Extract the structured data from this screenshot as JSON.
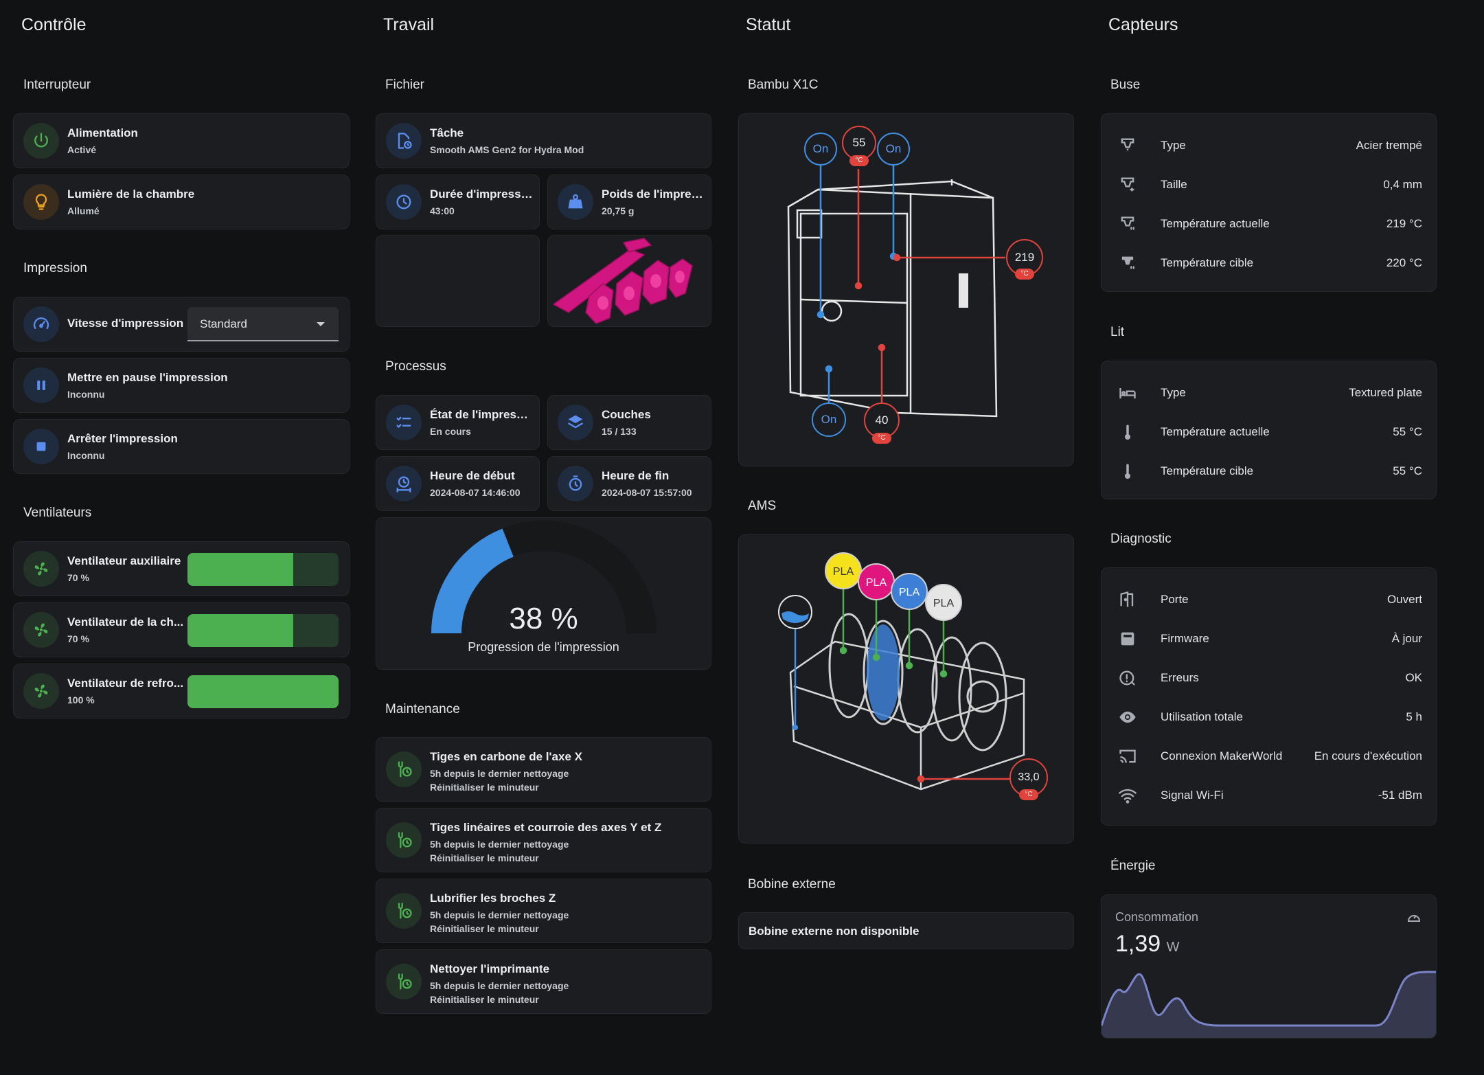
{
  "columns": {
    "controle": "Contrôle",
    "travail": "Travail",
    "statut": "Statut",
    "capteurs": "Capteurs"
  },
  "controle": {
    "interrupteur_title": "Interrupteur",
    "alimentation": {
      "name": "Alimentation",
      "value": "Activé"
    },
    "lumiere": {
      "name": "Lumière de la chambre",
      "value": "Allumé"
    },
    "impression_title": "Impression",
    "vitesse": {
      "name": "Vitesse d'impression",
      "selected": "Standard"
    },
    "pause": {
      "name": "Mettre en pause l'impression",
      "value": "Inconnu"
    },
    "arreter": {
      "name": "Arrêter l'impression",
      "value": "Inconnu"
    },
    "ventilateurs_title": "Ventilateurs",
    "fans": [
      {
        "name": "Ventilateur auxiliaire",
        "value": "70 %",
        "percent": 70
      },
      {
        "name": "Ventilateur de la ch...",
        "value": "70 %",
        "percent": 70
      },
      {
        "name": "Ventilateur de refro...",
        "value": "100 %",
        "percent": 100
      }
    ]
  },
  "travail": {
    "fichier_title": "Fichier",
    "tache": {
      "name": "Tâche",
      "value": "Smooth AMS Gen2 for Hydra Mod"
    },
    "duree": {
      "name": "Durée d'impression",
      "value": "43:00"
    },
    "poids": {
      "name": "Poids de l'impres...",
      "value": "20,75 g"
    },
    "processus_title": "Processus",
    "etat": {
      "name": "État de l'impressi...",
      "value": "En cours"
    },
    "couches": {
      "name": "Couches",
      "value": "15 / 133"
    },
    "debut": {
      "name": "Heure de début",
      "value": "2024-08-07 14:46:00"
    },
    "fin": {
      "name": "Heure de fin",
      "value": "2024-08-07 15:57:00"
    },
    "progress": {
      "value": "38 %",
      "label": "Progression de l'impression",
      "percent": 38
    },
    "maintenance_title": "Maintenance",
    "maintenance": [
      {
        "name": "Tiges en carbone de l'axe X",
        "since": "5h depuis le dernier nettoyage",
        "action": "Réinitialiser le minuteur"
      },
      {
        "name": "Tiges linéaires et courroie des axes Y et Z",
        "since": "5h depuis le dernier nettoyage",
        "action": "Réinitialiser le minuteur"
      },
      {
        "name": "Lubrifier les broches Z",
        "since": "5h depuis le dernier nettoyage",
        "action": "Réinitialiser le minuteur"
      },
      {
        "name": "Nettoyer l'imprimante",
        "since": "5h depuis le dernier nettoyage",
        "action": "Réinitialiser le minuteur"
      }
    ]
  },
  "statut": {
    "printer_title": "Bambu X1C",
    "badges": {
      "on1": "On",
      "bed_temp": "55",
      "on2": "On",
      "nozzle_temp": "219",
      "on3": "On",
      "chamber_temp": "40",
      "unit": "°C"
    },
    "ams_title": "AMS",
    "ams": {
      "slots": [
        "PLA",
        "PLA",
        "PLA",
        "PLA"
      ],
      "slot_colors": [
        "#f5e11c",
        "#e0157e",
        "#3d7fd6",
        "#e6e6e6"
      ],
      "humidity_temp": "33,0",
      "unit": "°C"
    },
    "bobine_title": "Bobine externe",
    "bobine_text": "Bobine externe non disponible"
  },
  "capteurs": {
    "buse_title": "Buse",
    "buse": [
      {
        "label": "Type",
        "value": "Acier trempé",
        "icon": "nozzle-icon"
      },
      {
        "label": "Taille",
        "value": "0,4 mm",
        "icon": "nozzle-size-icon"
      },
      {
        "label": "Température actuelle",
        "value": "219 °C",
        "icon": "nozzle-temp-icon"
      },
      {
        "label": "Température cible",
        "value": "220 °C",
        "icon": "nozzle-target-icon"
      }
    ],
    "lit_title": "Lit",
    "lit": [
      {
        "label": "Type",
        "value": "Textured plate",
        "icon": "bed-icon"
      },
      {
        "label": "Température actuelle",
        "value": "55 °C",
        "icon": "thermometer-icon"
      },
      {
        "label": "Température cible",
        "value": "55 °C",
        "icon": "thermometer-icon"
      }
    ],
    "diagnostic_title": "Diagnostic",
    "diagnostic": [
      {
        "label": "Porte",
        "value": "Ouvert",
        "icon": "door-icon"
      },
      {
        "label": "Firmware",
        "value": "À jour",
        "icon": "firmware-icon"
      },
      {
        "label": "Erreurs",
        "value": "OK",
        "icon": "alert-icon"
      },
      {
        "label": "Utilisation totale",
        "value": "5 h",
        "icon": "eye-icon"
      },
      {
        "label": "Connexion MakerWorld",
        "value": "En cours d'exécution",
        "icon": "cast-icon"
      },
      {
        "label": "Signal Wi-Fi",
        "value": "-51 dBm",
        "icon": "wifi-icon"
      }
    ],
    "energie_title": "Énergie",
    "energie": {
      "label": "Consommation",
      "value": "1,39",
      "unit": "W"
    }
  },
  "colors": {
    "green": "#4cb050",
    "blue": "#3f8fe0",
    "red": "#e0443c",
    "pink": "#e0157e",
    "bg": "#111213",
    "card": "#1c1d20"
  }
}
